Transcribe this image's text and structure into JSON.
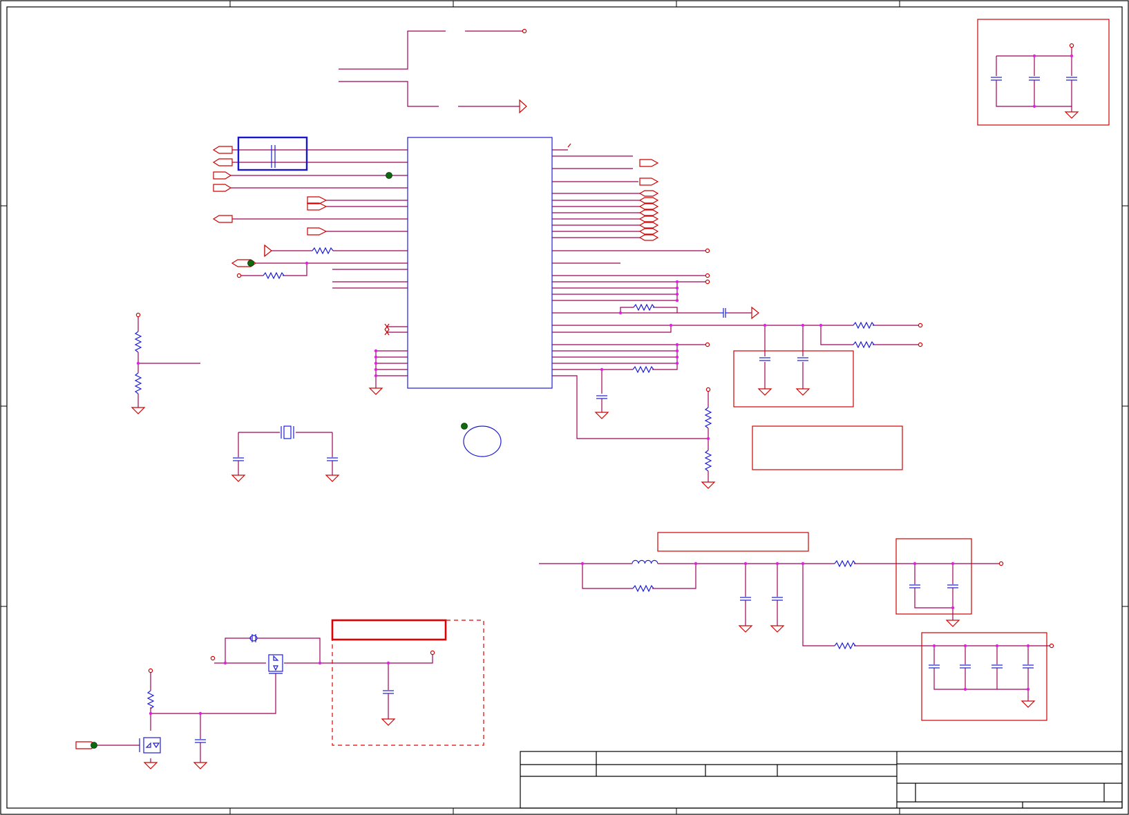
{
  "sheet": {
    "background": "#ffffff",
    "wire_color": "#a0005a",
    "pin_color": "#d00000",
    "part_color": "#1b1bd6",
    "junction_color": "#e020e0",
    "probe_color": "#0f6a0f"
  },
  "icons": [
    "resistor-icon",
    "capacitor-icon",
    "inductor-icon",
    "crystal-icon",
    "mosfet-icon",
    "ground-icon",
    "port-arrow-icon",
    "test-point-icon"
  ]
}
